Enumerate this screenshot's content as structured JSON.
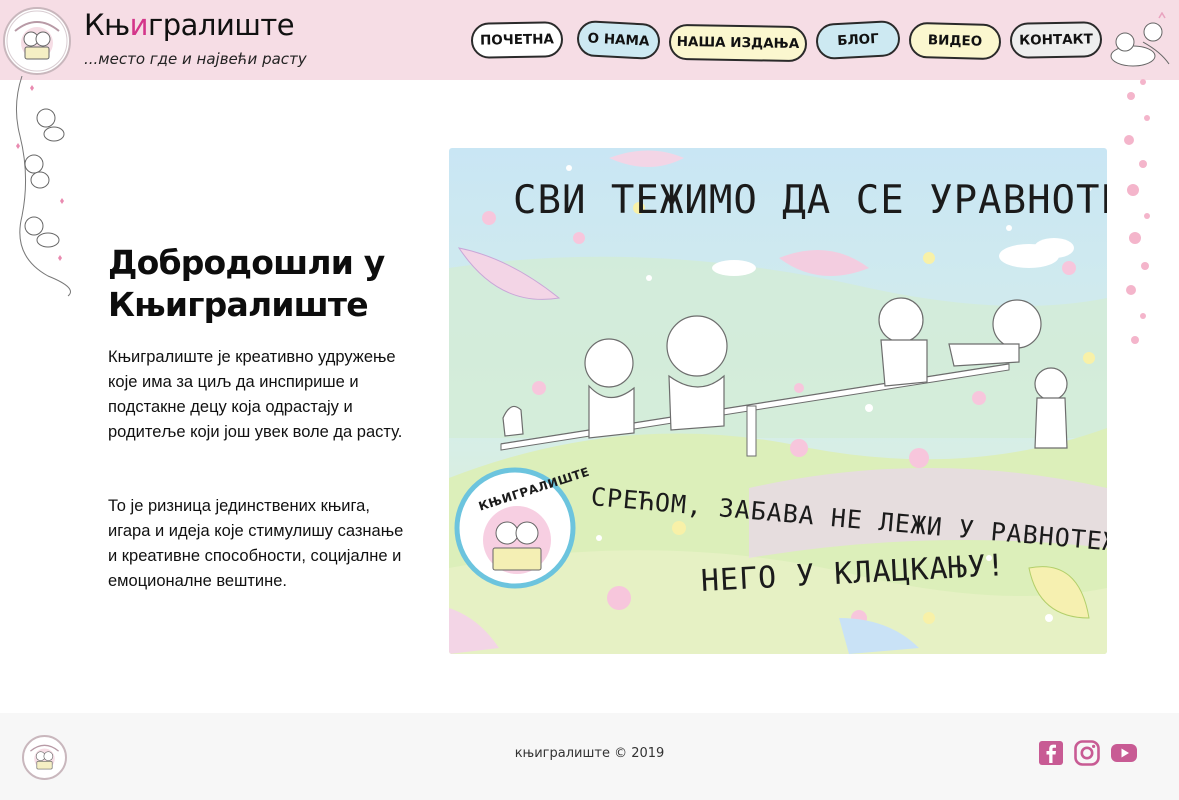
{
  "header": {
    "title_prefix": "Књ",
    "title_highlight": "и",
    "title_suffix": "гралиште",
    "subtitle": "...место где и највећи расту",
    "nav": [
      {
        "label": "ПОЧЕТНА",
        "bg": "#ffffff"
      },
      {
        "label": "О НАМА",
        "bg": "#cde9f2"
      },
      {
        "label": "НАША ИЗДАЊА",
        "bg": "#fbf7cf"
      },
      {
        "label": "БЛОГ",
        "bg": "#cde9f2"
      },
      {
        "label": "ВИДЕО",
        "bg": "#fbf7cf"
      },
      {
        "label": "КОНТАКТ",
        "bg": "#eeeeee"
      }
    ]
  },
  "main": {
    "heading": "Добродошли у Књигралиште",
    "paragraph_1": "Књигралиште је креативно удружење које има за циљ да инспирише и подстакне децу која одрастају и родитеље који још увек воле да расту.",
    "paragraph_2": "То је ризница јединствених књига, игара и идеја које стимулишу сазнање и креативне способности, социјалне и емоционалне вештине."
  },
  "hero": {
    "line_1": "СВИ ТЕЖИМО ДА СЕ УРАВНОТЕЖИМО.",
    "line_2": "СРЕЋОМ, ЗАБАВА НЕ ЛЕЖИ У РАВНОТЕЖИ,",
    "line_3": "НЕГО У КЛАЦКАЊУ!",
    "badge_text": "КЊИГРАЛИШТЕ"
  },
  "footer": {
    "copyright": "књигралиште © 2019",
    "social": [
      {
        "name": "facebook-icon",
        "color": "#c85b94"
      },
      {
        "name": "instagram-icon",
        "color": "#c85b94"
      },
      {
        "name": "youtube-icon",
        "color": "#c85b94"
      }
    ]
  },
  "colors": {
    "header_bg": "#f6dde5",
    "accent_pink": "#d4358a",
    "footer_bg": "#f7f7f7"
  }
}
